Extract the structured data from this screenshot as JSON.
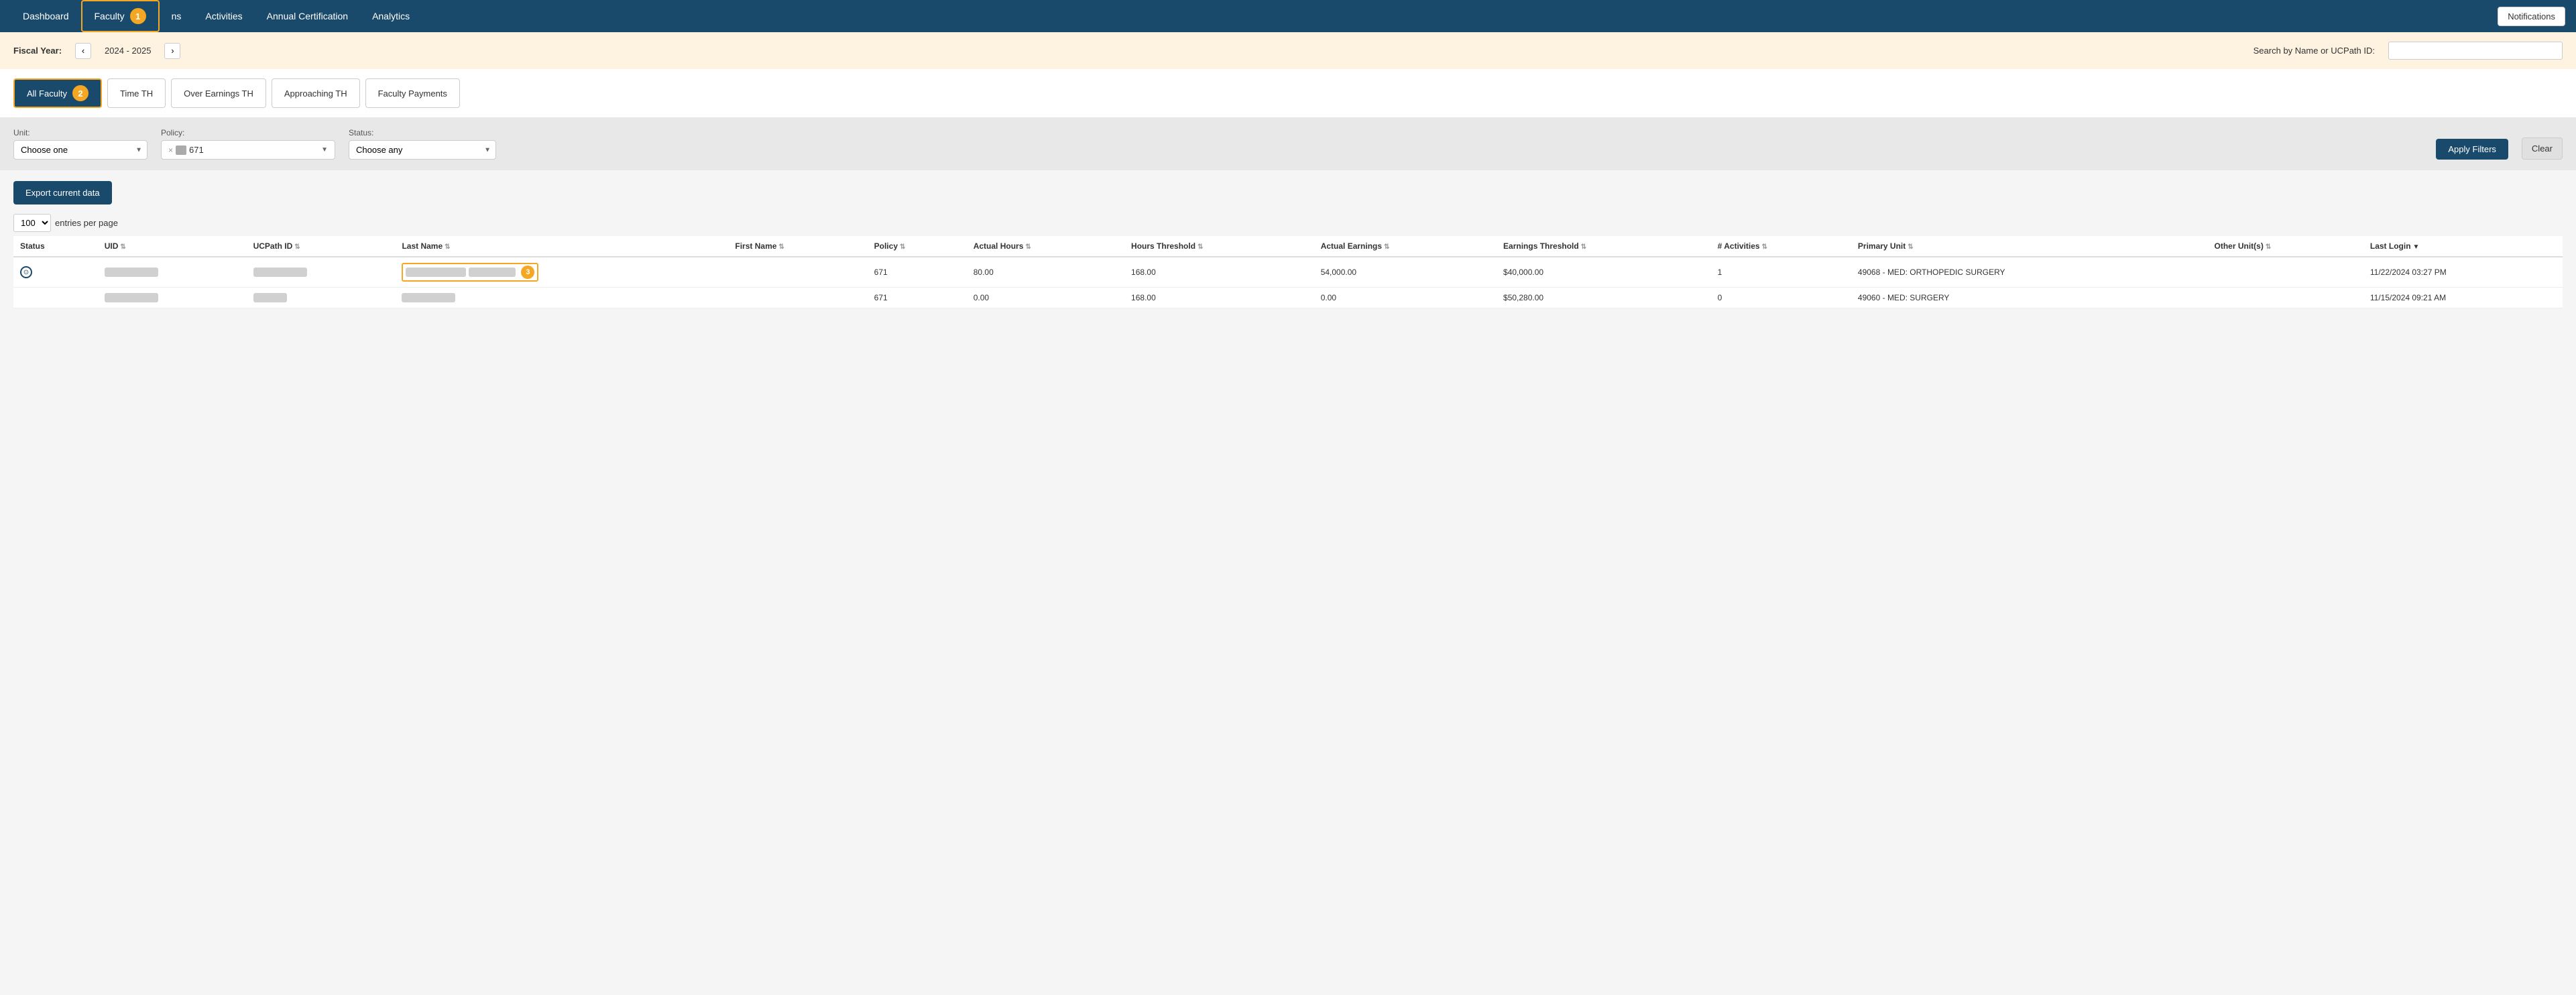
{
  "nav": {
    "items": [
      {
        "label": "Dashboard",
        "active": false
      },
      {
        "label": "Faculty",
        "active": true
      },
      {
        "label": "ns",
        "active": false
      },
      {
        "label": "Activities",
        "active": false
      },
      {
        "label": "Annual Certification",
        "active": false
      },
      {
        "label": "Analytics",
        "active": false
      }
    ],
    "notifications_label": "Notifications"
  },
  "fiscal": {
    "label": "Fiscal Year:",
    "year": "2024 - 2025",
    "search_label": "Search by Name or UCPath ID:",
    "search_placeholder": ""
  },
  "tabs": [
    {
      "label": "All Faculty",
      "active": true
    },
    {
      "label": "Time TH",
      "active": false
    },
    {
      "label": "Over Earnings TH",
      "active": false
    },
    {
      "label": "Approaching TH",
      "active": false
    },
    {
      "label": "Faculty Payments",
      "active": false
    }
  ],
  "filters": {
    "unit_label": "Unit:",
    "unit_placeholder": "Choose one",
    "policy_label": "Policy:",
    "policy_value": "671",
    "policy_x": "×",
    "status_label": "Status:",
    "status_placeholder": "Choose any",
    "apply_label": "Apply Filters",
    "clear_label": "Clear"
  },
  "toolbar": {
    "export_label": "Export current data",
    "entries_value": "100",
    "entries_label": "entries per page"
  },
  "table": {
    "columns": [
      {
        "label": "Status",
        "sortable": false
      },
      {
        "label": "UID",
        "sortable": true
      },
      {
        "label": "UCPath ID",
        "sortable": true
      },
      {
        "label": "Last Name",
        "sortable": true
      },
      {
        "label": "First Name",
        "sortable": true
      },
      {
        "label": "Policy",
        "sortable": true
      },
      {
        "label": "Actual Hours",
        "sortable": true
      },
      {
        "label": "Hours Threshold",
        "sortable": true
      },
      {
        "label": "Actual Earnings",
        "sortable": true
      },
      {
        "label": "Earnings Threshold",
        "sortable": true
      },
      {
        "label": "# Activities",
        "sortable": true
      },
      {
        "label": "Primary Unit",
        "sortable": true
      },
      {
        "label": "Other Unit(s)",
        "sortable": true
      },
      {
        "label": "Last Login",
        "sortable": true
      }
    ],
    "rows": [
      {
        "status_icon": "⊙",
        "uid": "BLURRED",
        "ucpath_id": "BLURRED",
        "last_name": "BLURRED_HIGHLIGHTED",
        "first_name": "BLURRED_HIGHLIGHTED",
        "policy": "671",
        "actual_hours": "80.00",
        "hours_threshold": "168.00",
        "actual_earnings": "54,000.00",
        "earnings_threshold": "$40,000.00",
        "activities": "1",
        "primary_unit": "49068 - MED: ORTHOPEDIC SURGERY",
        "other_units": "",
        "last_login": "11/22/2024 03:27 PM",
        "highlighted": true
      },
      {
        "status_icon": "",
        "uid": "BLURRED",
        "ucpath_id": "BLURRED_SM",
        "last_name": "BLURRED",
        "first_name": "",
        "policy": "671",
        "actual_hours": "0.00",
        "hours_threshold": "168.00",
        "actual_earnings": "0.00",
        "earnings_threshold": "$50,280.00",
        "activities": "0",
        "primary_unit": "49060 - MED: SURGERY",
        "other_units": "",
        "last_login": "11/15/2024 09:21 AM",
        "highlighted": false
      }
    ]
  },
  "badges": {
    "step1": "1",
    "step2": "2",
    "step3": "3"
  }
}
